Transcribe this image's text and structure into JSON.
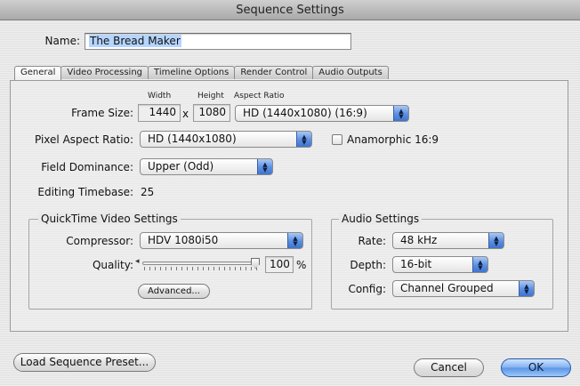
{
  "window": {
    "title": "Sequence Settings"
  },
  "name_field": {
    "label": "Name:",
    "value": "The Bread Maker"
  },
  "tabs": [
    {
      "label": "General",
      "active": true
    },
    {
      "label": "Video Processing",
      "active": false
    },
    {
      "label": "Timeline Options",
      "active": false
    },
    {
      "label": "Render Control",
      "active": false
    },
    {
      "label": "Audio Outputs",
      "active": false
    }
  ],
  "general": {
    "frame_size": {
      "label": "Frame Size:",
      "width_header": "Width",
      "height_header": "Height",
      "aspect_header": "Aspect Ratio",
      "width": "1440",
      "times": "x",
      "height": "1080",
      "aspect_ratio": "HD (1440x1080) (16:9)"
    },
    "pixel_aspect": {
      "label": "Pixel Aspect Ratio:",
      "value": "HD (1440x1080)"
    },
    "anamorphic": {
      "label": "Anamorphic 16:9",
      "checked": false
    },
    "field_dominance": {
      "label": "Field Dominance:",
      "value": "Upper (Odd)"
    },
    "timebase": {
      "label": "Editing Timebase:",
      "value": "25"
    },
    "quicktime": {
      "title": "QuickTime Video Settings",
      "compressor_label": "Compressor:",
      "compressor": "HDV 1080i50",
      "quality_label": "Quality:",
      "quality": "100",
      "quality_unit": "%",
      "quality_fraction": 1.0,
      "advanced_button": "Advanced..."
    },
    "audio": {
      "title": "Audio Settings",
      "rate_label": "Rate:",
      "rate": "48 kHz",
      "depth_label": "Depth:",
      "depth": "16-bit",
      "config_label": "Config:",
      "config": "Channel Grouped"
    }
  },
  "footer": {
    "load_preset": "Load Sequence Preset...",
    "cancel": "Cancel",
    "ok": "OK"
  },
  "colors": {
    "accent": "#5a95e6",
    "selection": "#b5d5ff"
  },
  "icons": {
    "popup_arrow": "up-down-arrows-icon"
  }
}
